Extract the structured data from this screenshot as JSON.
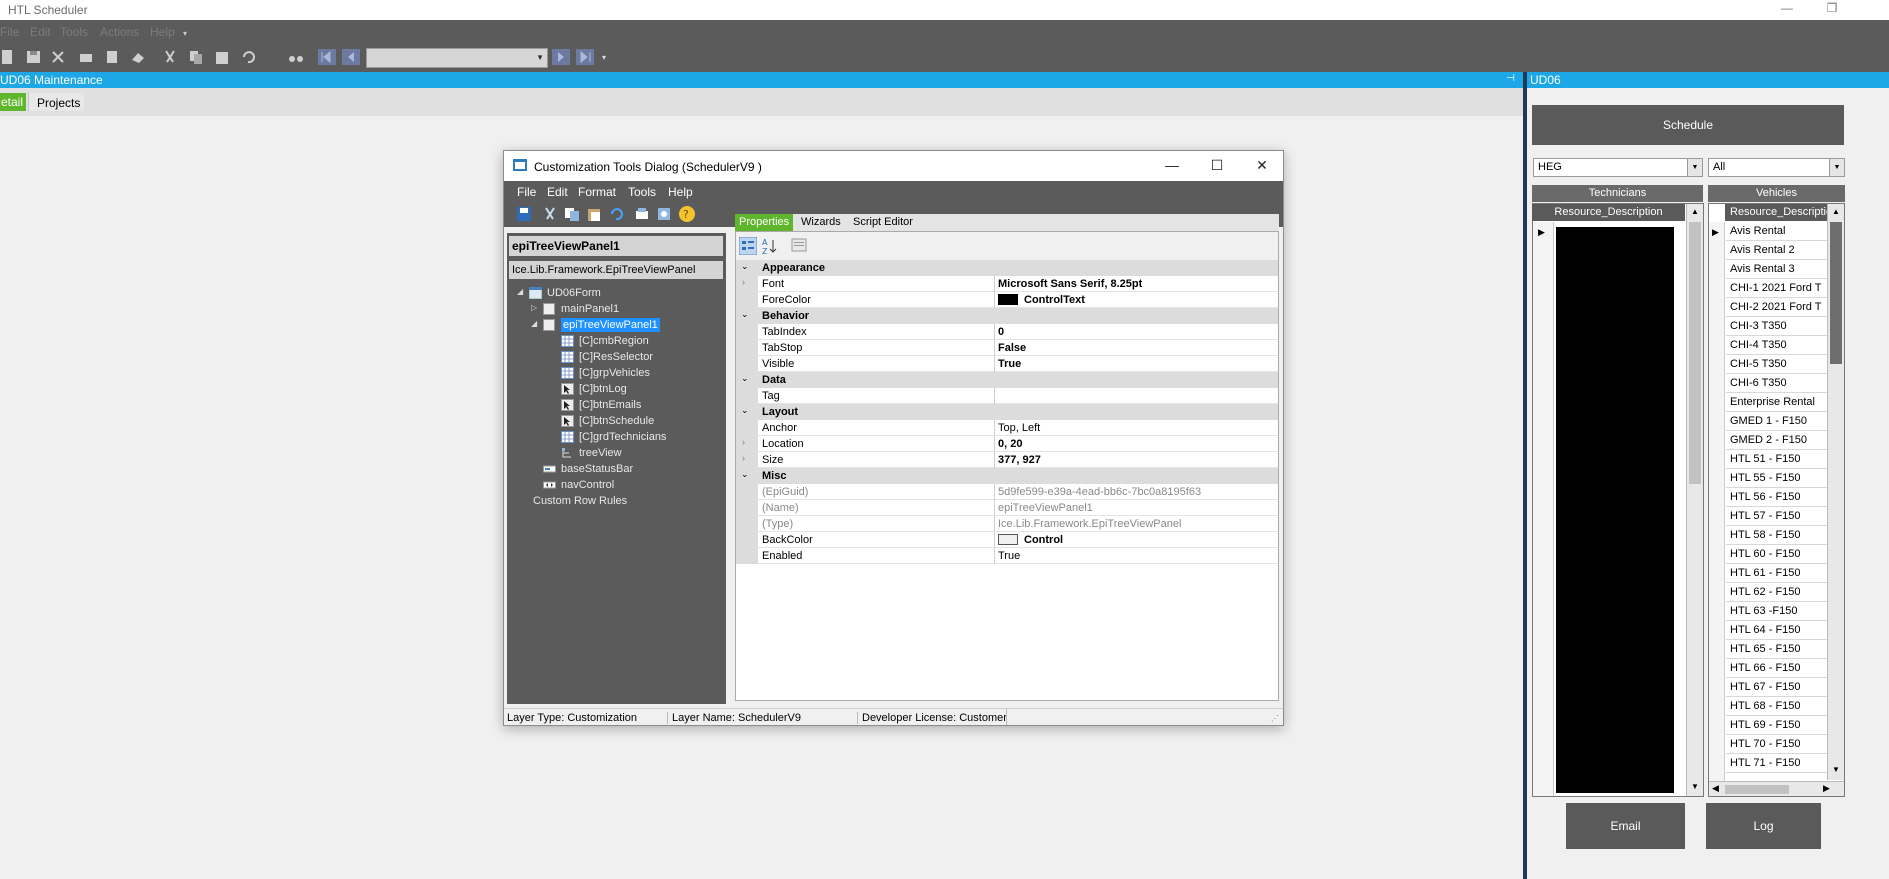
{
  "window": {
    "title": "HTL Scheduler",
    "minimize": "—",
    "restore": "❐"
  },
  "menubar": {
    "items": [
      "File",
      "Edit",
      "Tools",
      "Actions",
      "Help"
    ]
  },
  "maintenance": {
    "header": "UD06 Maintenance",
    "tabs": [
      "etail",
      "Projects"
    ]
  },
  "dock": {
    "header": "UD06",
    "schedule_button": "Schedule",
    "region_value": "HEG",
    "resource_value": "All",
    "technicians_title": "Technicians",
    "vehicles_title": "Vehicles",
    "tech_column": "Resource_Description",
    "veh_column": "Resource_Descriptio",
    "vehicles": [
      "Avis Rental",
      "Avis Rental 2",
      "Avis Rental 3",
      "CHI-1 2021 Ford T",
      "CHI-2 2021 Ford T",
      "CHI-3 T350",
      "CHI-4 T350",
      "CHI-5 T350",
      "CHI-6 T350",
      "Enterprise Rental",
      "GMED 1 - F150",
      "GMED 2 - F150",
      "HTL 51 - F150",
      "HTL 55 - F150",
      "HTL 56 - F150",
      "HTL 57 - F150",
      "HTL 58 - F150",
      "HTL 60 - F150",
      "HTL 61 - F150",
      "HTL 62 - F150",
      "HTL 63 -F150",
      "HTL 64 - F150",
      "HTL 65 - F150",
      "HTL 66 - F150",
      "HTL 67 - F150",
      "HTL 68 - F150",
      "HTL 69 - F150",
      "HTL 70 - F150",
      "HTL 71 - F150"
    ],
    "email_button": "Email",
    "log_button": "Log"
  },
  "dialog": {
    "title": "Customization Tools Dialog  (SchedulerV9 )",
    "menu": [
      "File",
      "Edit",
      "Format",
      "Tools",
      "Help"
    ],
    "selected_name": "epiTreeViewPanel1",
    "selected_type": "Ice.Lib.Framework.EpiTreeViewPanel",
    "tree": [
      {
        "label": "UD06Form"
      },
      {
        "label": "mainPanel1"
      },
      {
        "label": "epiTreeViewPanel1"
      },
      {
        "label": "[C]cmbRegion"
      },
      {
        "label": "[C]ResSelector"
      },
      {
        "label": "[C]grpVehicles"
      },
      {
        "label": "[C]btnLog"
      },
      {
        "label": "[C]btnEmails"
      },
      {
        "label": "[C]btnSchedule"
      },
      {
        "label": "[C]grdTechnicians"
      },
      {
        "label": "treeView"
      },
      {
        "label": "baseStatusBar"
      },
      {
        "label": "navControl"
      },
      {
        "label": "Custom Row Rules"
      }
    ],
    "tabs": [
      "Properties",
      "Wizards",
      "Script Editor"
    ],
    "categories": {
      "appearance": "Appearance",
      "behavior": "Behavior",
      "data": "Data",
      "layout": "Layout",
      "misc": "Misc"
    },
    "props": {
      "font_k": "Font",
      "font_v": "Microsoft Sans Serif, 8.25pt",
      "forecolor_k": "ForeColor",
      "forecolor_v": "ControlText",
      "tabindex_k": "TabIndex",
      "tabindex_v": "0",
      "tabstop_k": "TabStop",
      "tabstop_v": "False",
      "visible_k": "Visible",
      "visible_v": "True",
      "tag_k": "Tag",
      "tag_v": "",
      "anchor_k": "Anchor",
      "anchor_v": "Top, Left",
      "location_k": "Location",
      "location_v": "0, 20",
      "size_k": "Size",
      "size_v": "377, 927",
      "epiguid_k": "(EpiGuid)",
      "epiguid_v": "5d9fe599-e39a-4ead-bb6c-7bc0a8195f63",
      "name_k": "(Name)",
      "name_v": "epiTreeViewPanel1",
      "type_k": "(Type)",
      "type_v": "Ice.Lib.Framework.EpiTreeViewPanel",
      "backcolor_k": "BackColor",
      "backcolor_v": "Control",
      "enabled_k": "Enabled",
      "enabled_v": "True"
    },
    "status": {
      "layer_type": "Layer Type:  Customization",
      "layer_name": "Layer Name:  SchedulerV9",
      "license": "Developer License:  Customer"
    }
  },
  "colors": {
    "accent": "#1ea7e6",
    "toolbar": "#5b5b5b",
    "active_tab": "#5fb52b",
    "tree_selection": "#1e90ff"
  }
}
